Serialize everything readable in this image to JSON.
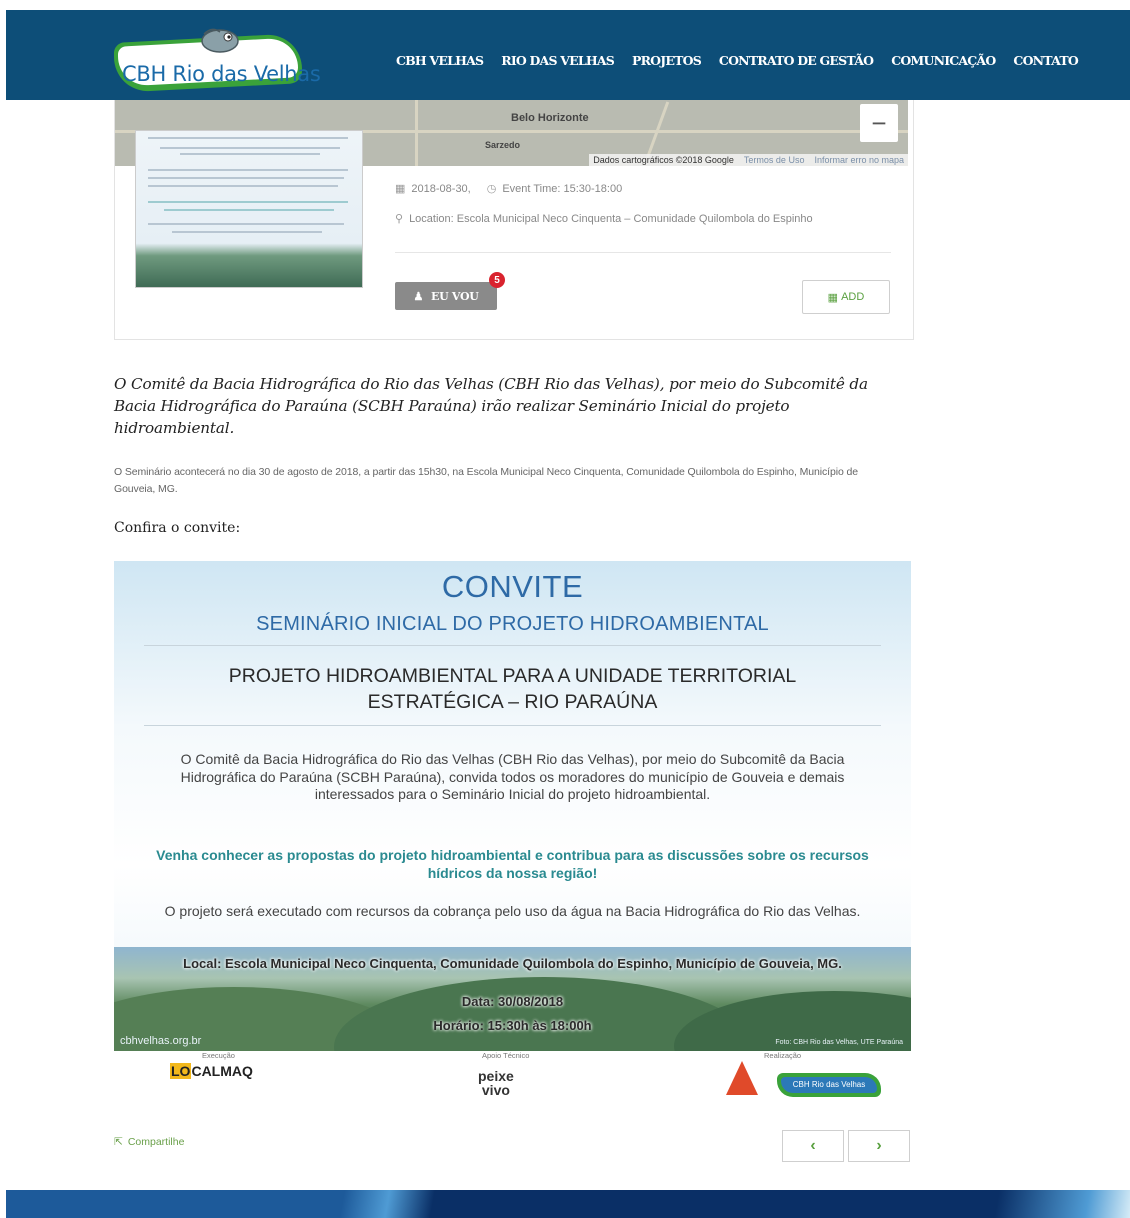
{
  "header": {
    "logo_text": "CBH Rio das Velhas",
    "nav": [
      "CBH VELHAS",
      "RIO DAS VELHAS",
      "PROJETOS",
      "CONTRATO DE GESTÃO",
      "COMUNICAÇÃO",
      "CONTATO"
    ]
  },
  "map": {
    "labels": [
      "Belo Horizonte",
      "Sarzedo"
    ],
    "zoom_out": "−",
    "attribution": "Dados cartográficos ©2018 Google",
    "terms": "Termos de Uso",
    "report": "Informar erro no mapa"
  },
  "event": {
    "date": "2018-08-30,",
    "time": "Event Time: 15:30-18:00",
    "location": "Location: Escola Municipal Neco Cinquenta – Comunidade Quilombola do Espinho",
    "go_label": "EU VOU",
    "go_count": "5",
    "add_label": "ADD"
  },
  "article": {
    "lead": "O Comitê da Bacia Hidrográfica do Rio das Velhas (CBH Rio das Velhas), por meio do Subcomitê da Bacia Hidrográfica do Paraúna (SCBH Paraúna) irão realizar Seminário Inicial do projeto hidroambiental.",
    "body": "O Seminário acontecerá no dia 30 de agosto de 2018, a partir das 15h30, na Escola Municipal Neco Cinquenta, Comunidade Quilombola do Espinho, Município de Gouveia, MG.",
    "confira": "Confira o convite:"
  },
  "invite": {
    "title": "CONVITE",
    "subtitle": "SEMINÁRIO INICIAL DO PROJETO HIDROAMBIENTAL",
    "project": "PROJETO HIDROAMBIENTAL PARA A UNIDADE TERRITORIAL ESTRATÉGICA – RIO PARAÚNA",
    "p1": "O Comitê da Bacia Hidrográfica do Rio das Velhas (CBH Rio das Velhas), por meio do Subcomitê da Bacia Hidrográfica do Paraúna (SCBH Paraúna), convida todos os moradores do município de Gouveia e demais interessados para o Seminário Inicial do projeto hidroambiental.",
    "p2": "Venha conhecer as propostas do projeto hidroambiental e contribua para as discussões sobre os recursos hídricos da nossa região!",
    "p3": "O projeto será executado com recursos da cobrança pelo uso da água na Bacia Hidrográfica do Rio das Velhas.",
    "local": "Local: Escola Municipal Neco Cinquenta, Comunidade Quilombola do Espinho, Município de Gouveia, MG.",
    "data": "Data: 30/08/2018",
    "horario": "Horário: 15:30h às 18:00h",
    "url": "cbhvelhas.org.br",
    "credit": "Foto: CBH Rio das Velhas, UTE Paraúna",
    "execucao": "Execução",
    "apoio": "Apoio Técnico",
    "realizacao": "Realização",
    "localmaq_lo": "LO",
    "localmaq_rest": "CALMAQ",
    "peixe1": "peixe",
    "peixe2": "vivo",
    "cbh_mini": "CBH Rio das Velhas"
  },
  "footer": {
    "share": "Compartilhe",
    "prev": "‹",
    "next": "›"
  }
}
